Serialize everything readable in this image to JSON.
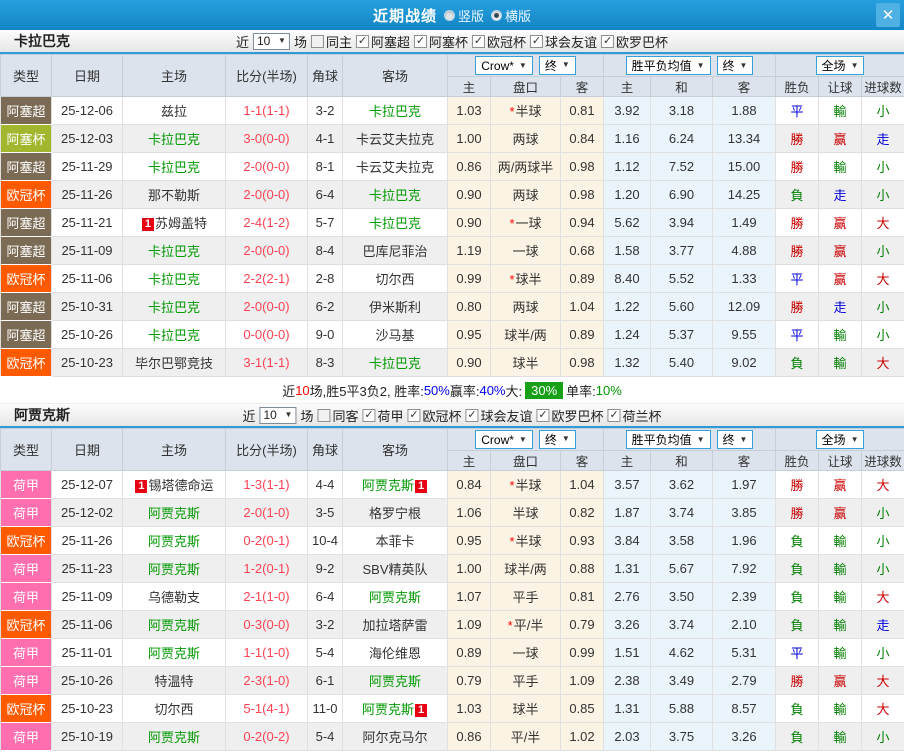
{
  "titlebar": {
    "title": "近期战绩",
    "radio_vertical": "竖版",
    "radio_horizontal": "横版",
    "close_glyph": "✕"
  },
  "table_header": {
    "left_columns": [
      "类型",
      "日期",
      "主场",
      "比分(半场)",
      "角球",
      "客场"
    ],
    "sub_columns": [
      "主",
      "盘口",
      "客",
      "主",
      "和",
      "客",
      "胜负",
      "让球",
      "进球数"
    ],
    "dropdown_groups": [
      [
        "Crow*",
        "终"
      ],
      [
        "胜平负均值",
        "终"
      ],
      [
        "全场"
      ]
    ]
  },
  "colors": {
    "topbar_blue": "#1b93d0",
    "accent_blue": "#2f9bd6",
    "score_red": "#ff4353",
    "team_green": "#009900",
    "badge_red": "#e60012",
    "summary_badge_green": "#18a018"
  },
  "league_colors": {
    "阿塞超": "#7b6a54",
    "阿塞杯": "#a2b62e",
    "欧冠杯": "#ff5a00",
    "荷甲": "#ff6eae"
  },
  "result_colors": {
    "勝": "#cc0000",
    "平": "#0000dd",
    "負": "#008000",
    "赢": "#cc0000",
    "走": "#0000dd",
    "輸": "#008000",
    "大": "#cc0000",
    "小": "#008000"
  },
  "sections": [
    {
      "team": "卡拉巴克",
      "filter": {
        "prefix": "近",
        "count": "10",
        "suffix": "场",
        "same": {
          "label": "同主",
          "checked": false
        },
        "leagues": [
          {
            "label": "阿塞超",
            "checked": true
          },
          {
            "label": "阿塞杯",
            "checked": true
          },
          {
            "label": "欧冠杯",
            "checked": true
          },
          {
            "label": "球会友谊",
            "checked": true
          },
          {
            "label": "欧罗巴杯",
            "checked": true
          }
        ]
      },
      "rows": [
        {
          "league": "阿塞超",
          "date": "25-12-06",
          "home": "兹拉",
          "home_green": false,
          "home_badge": "",
          "score": "1-1",
          "half": "(1-1)",
          "corner": "3-2",
          "away": "卡拉巴克",
          "away_green": true,
          "away_badge": "",
          "crow": [
            "1.03",
            "*半球",
            "0.81"
          ],
          "avg": [
            "3.92",
            "3.18",
            "1.88"
          ],
          "res": [
            "平",
            "輸",
            "小"
          ]
        },
        {
          "league": "阿塞杯",
          "date": "25-12-03",
          "home": "卡拉巴克",
          "home_green": true,
          "home_badge": "",
          "score": "3-0",
          "half": "(0-0)",
          "corner": "4-1",
          "away": "卡云艾夫拉克",
          "away_green": false,
          "away_badge": "",
          "crow": [
            "1.00",
            "两球",
            "0.84"
          ],
          "avg": [
            "1.16",
            "6.24",
            "13.34"
          ],
          "res": [
            "勝",
            "赢",
            "走"
          ]
        },
        {
          "league": "阿塞超",
          "date": "25-11-29",
          "home": "卡拉巴克",
          "home_green": true,
          "home_badge": "",
          "score": "2-0",
          "half": "(0-0)",
          "corner": "8-1",
          "away": "卡云艾夫拉克",
          "away_green": false,
          "away_badge": "",
          "crow": [
            "0.86",
            "两/两球半",
            "0.98"
          ],
          "avg": [
            "1.12",
            "7.52",
            "15.00"
          ],
          "res": [
            "勝",
            "輸",
            "小"
          ]
        },
        {
          "league": "欧冠杯",
          "date": "25-11-26",
          "home": "那不勒斯",
          "home_green": false,
          "home_badge": "",
          "score": "2-0",
          "half": "(0-0)",
          "corner": "6-4",
          "away": "卡拉巴克",
          "away_green": true,
          "away_badge": "",
          "crow": [
            "0.90",
            "两球",
            "0.98"
          ],
          "avg": [
            "1.20",
            "6.90",
            "14.25"
          ],
          "res": [
            "負",
            "走",
            "小"
          ]
        },
        {
          "league": "阿塞超",
          "date": "25-11-21",
          "home": "苏姆盖特",
          "home_green": false,
          "home_badge": "1",
          "score": "2-4",
          "half": "(1-2)",
          "corner": "5-7",
          "away": "卡拉巴克",
          "away_green": true,
          "away_badge": "",
          "crow": [
            "0.90",
            "*一球",
            "0.94"
          ],
          "avg": [
            "5.62",
            "3.94",
            "1.49"
          ],
          "res": [
            "勝",
            "赢",
            "大"
          ]
        },
        {
          "league": "阿塞超",
          "date": "25-11-09",
          "home": "卡拉巴克",
          "home_green": true,
          "home_badge": "",
          "score": "2-0",
          "half": "(0-0)",
          "corner": "8-4",
          "away": "巴库尼菲治",
          "away_green": false,
          "away_badge": "",
          "crow": [
            "1.19",
            "一球",
            "0.68"
          ],
          "avg": [
            "1.58",
            "3.77",
            "4.88"
          ],
          "res": [
            "勝",
            "赢",
            "小"
          ]
        },
        {
          "league": "欧冠杯",
          "date": "25-11-06",
          "home": "卡拉巴克",
          "home_green": true,
          "home_badge": "",
          "score": "2-2",
          "half": "(2-1)",
          "corner": "2-8",
          "away": "切尔西",
          "away_green": false,
          "away_badge": "",
          "crow": [
            "0.99",
            "*球半",
            "0.89"
          ],
          "avg": [
            "8.40",
            "5.52",
            "1.33"
          ],
          "res": [
            "平",
            "赢",
            "大"
          ]
        },
        {
          "league": "阿塞超",
          "date": "25-10-31",
          "home": "卡拉巴克",
          "home_green": true,
          "home_badge": "",
          "score": "2-0",
          "half": "(0-0)",
          "corner": "6-2",
          "away": "伊米斯利",
          "away_green": false,
          "away_badge": "",
          "crow": [
            "0.80",
            "两球",
            "1.04"
          ],
          "avg": [
            "1.22",
            "5.60",
            "12.09"
          ],
          "res": [
            "勝",
            "走",
            "小"
          ]
        },
        {
          "league": "阿塞超",
          "date": "25-10-26",
          "home": "卡拉巴克",
          "home_green": true,
          "home_badge": "",
          "score": "0-0",
          "half": "(0-0)",
          "corner": "9-0",
          "away": "沙马基",
          "away_green": false,
          "away_badge": "",
          "crow": [
            "0.95",
            "球半/两",
            "0.89"
          ],
          "avg": [
            "1.24",
            "5.37",
            "9.55"
          ],
          "res": [
            "平",
            "輸",
            "小"
          ]
        },
        {
          "league": "欧冠杯",
          "date": "25-10-23",
          "home": "毕尔巴鄂竞技",
          "home_green": false,
          "home_badge": "",
          "score": "3-1",
          "half": "(1-1)",
          "corner": "8-3",
          "away": "卡拉巴克",
          "away_green": true,
          "away_badge": "",
          "crow": [
            "0.90",
            "球半",
            "0.98"
          ],
          "avg": [
            "1.32",
            "5.40",
            "9.02"
          ],
          "res": [
            "負",
            "輸",
            "大"
          ]
        }
      ],
      "summary": [
        {
          "text": "近",
          "style": "p"
        },
        {
          "text": "10",
          "style": "r"
        },
        {
          "text": "场,胜5平3负2, 胜率:",
          "style": "p"
        },
        {
          "text": "50%",
          "style": "b"
        },
        {
          "text": " 赢率:",
          "style": "p"
        },
        {
          "text": "40%",
          "style": "b"
        },
        {
          "text": " 大: ",
          "style": "p"
        },
        {
          "text": "30%",
          "style": "gb"
        },
        {
          "text": " 单率:",
          "style": "p"
        },
        {
          "text": "10%",
          "style": "g"
        }
      ]
    },
    {
      "team": "阿贾克斯",
      "filter": {
        "prefix": "近",
        "count": "10",
        "suffix": "场",
        "same": {
          "label": "同客",
          "checked": false
        },
        "leagues": [
          {
            "label": "荷甲",
            "checked": true
          },
          {
            "label": "欧冠杯",
            "checked": true
          },
          {
            "label": "球会友谊",
            "checked": true
          },
          {
            "label": "欧罗巴杯",
            "checked": true
          },
          {
            "label": "荷兰杯",
            "checked": true
          }
        ]
      },
      "rows": [
        {
          "league": "荷甲",
          "date": "25-12-07",
          "home": "锡塔德命运",
          "home_green": false,
          "home_badge": "1",
          "score": "1-3",
          "half": "(1-1)",
          "corner": "4-4",
          "away": "阿贾克斯",
          "away_green": true,
          "away_badge": "1",
          "crow": [
            "0.84",
            "*半球",
            "1.04"
          ],
          "avg": [
            "3.57",
            "3.62",
            "1.97"
          ],
          "res": [
            "勝",
            "赢",
            "大"
          ]
        },
        {
          "league": "荷甲",
          "date": "25-12-02",
          "home": "阿贾克斯",
          "home_green": true,
          "home_badge": "",
          "score": "2-0",
          "half": "(1-0)",
          "corner": "3-5",
          "away": "格罗宁根",
          "away_green": false,
          "away_badge": "",
          "crow": [
            "1.06",
            "半球",
            "0.82"
          ],
          "avg": [
            "1.87",
            "3.74",
            "3.85"
          ],
          "res": [
            "勝",
            "赢",
            "小"
          ]
        },
        {
          "league": "欧冠杯",
          "date": "25-11-26",
          "home": "阿贾克斯",
          "home_green": true,
          "home_badge": "",
          "score": "0-2",
          "half": "(0-1)",
          "corner": "10-4",
          "away": "本菲卡",
          "away_green": false,
          "away_badge": "",
          "crow": [
            "0.95",
            "*半球",
            "0.93"
          ],
          "avg": [
            "3.84",
            "3.58",
            "1.96"
          ],
          "res": [
            "負",
            "輸",
            "小"
          ]
        },
        {
          "league": "荷甲",
          "date": "25-11-23",
          "home": "阿贾克斯",
          "home_green": true,
          "home_badge": "",
          "score": "1-2",
          "half": "(0-1)",
          "corner": "9-2",
          "away": "SBV精英队",
          "away_green": false,
          "away_badge": "",
          "crow": [
            "1.00",
            "球半/两",
            "0.88"
          ],
          "avg": [
            "1.31",
            "5.67",
            "7.92"
          ],
          "res": [
            "負",
            "輸",
            "小"
          ]
        },
        {
          "league": "荷甲",
          "date": "25-11-09",
          "home": "乌德勒支",
          "home_green": false,
          "home_badge": "",
          "score": "2-1",
          "half": "(1-0)",
          "corner": "6-4",
          "away": "阿贾克斯",
          "away_green": true,
          "away_badge": "",
          "crow": [
            "1.07",
            "平手",
            "0.81"
          ],
          "avg": [
            "2.76",
            "3.50",
            "2.39"
          ],
          "res": [
            "負",
            "輸",
            "大"
          ]
        },
        {
          "league": "欧冠杯",
          "date": "25-11-06",
          "home": "阿贾克斯",
          "home_green": true,
          "home_badge": "",
          "score": "0-3",
          "half": "(0-0)",
          "corner": "3-2",
          "away": "加拉塔萨雷",
          "away_green": false,
          "away_badge": "",
          "crow": [
            "1.09",
            "*平/半",
            "0.79"
          ],
          "avg": [
            "3.26",
            "3.74",
            "2.10"
          ],
          "res": [
            "負",
            "輸",
            "走"
          ]
        },
        {
          "league": "荷甲",
          "date": "25-11-01",
          "home": "阿贾克斯",
          "home_green": true,
          "home_badge": "",
          "score": "1-1",
          "half": "(1-0)",
          "corner": "5-4",
          "away": "海伦维恩",
          "away_green": false,
          "away_badge": "",
          "crow": [
            "0.89",
            "一球",
            "0.99"
          ],
          "avg": [
            "1.51",
            "4.62",
            "5.31"
          ],
          "res": [
            "平",
            "輸",
            "小"
          ]
        },
        {
          "league": "荷甲",
          "date": "25-10-26",
          "home": "特温特",
          "home_green": false,
          "home_badge": "",
          "score": "2-3",
          "half": "(1-0)",
          "corner": "6-1",
          "away": "阿贾克斯",
          "away_green": true,
          "away_badge": "",
          "crow": [
            "0.79",
            "平手",
            "1.09"
          ],
          "avg": [
            "2.38",
            "3.49",
            "2.79"
          ],
          "res": [
            "勝",
            "赢",
            "大"
          ]
        },
        {
          "league": "欧冠杯",
          "date": "25-10-23",
          "home": "切尔西",
          "home_green": false,
          "home_badge": "",
          "score": "5-1",
          "half": "(4-1)",
          "corner": "11-0",
          "away": "阿贾克斯",
          "away_green": true,
          "away_badge": "1",
          "crow": [
            "1.03",
            "球半",
            "0.85"
          ],
          "avg": [
            "1.31",
            "5.88",
            "8.57"
          ],
          "res": [
            "負",
            "輸",
            "大"
          ]
        },
        {
          "league": "荷甲",
          "date": "25-10-19",
          "home": "阿贾克斯",
          "home_green": true,
          "home_badge": "",
          "score": "0-2",
          "half": "(0-2)",
          "corner": "5-4",
          "away": "阿尔克马尔",
          "away_green": false,
          "away_badge": "",
          "crow": [
            "0.86",
            "平/半",
            "1.02"
          ],
          "avg": [
            "2.03",
            "3.75",
            "3.26"
          ],
          "res": [
            "負",
            "輸",
            "小"
          ]
        }
      ],
      "summary": null
    }
  ]
}
